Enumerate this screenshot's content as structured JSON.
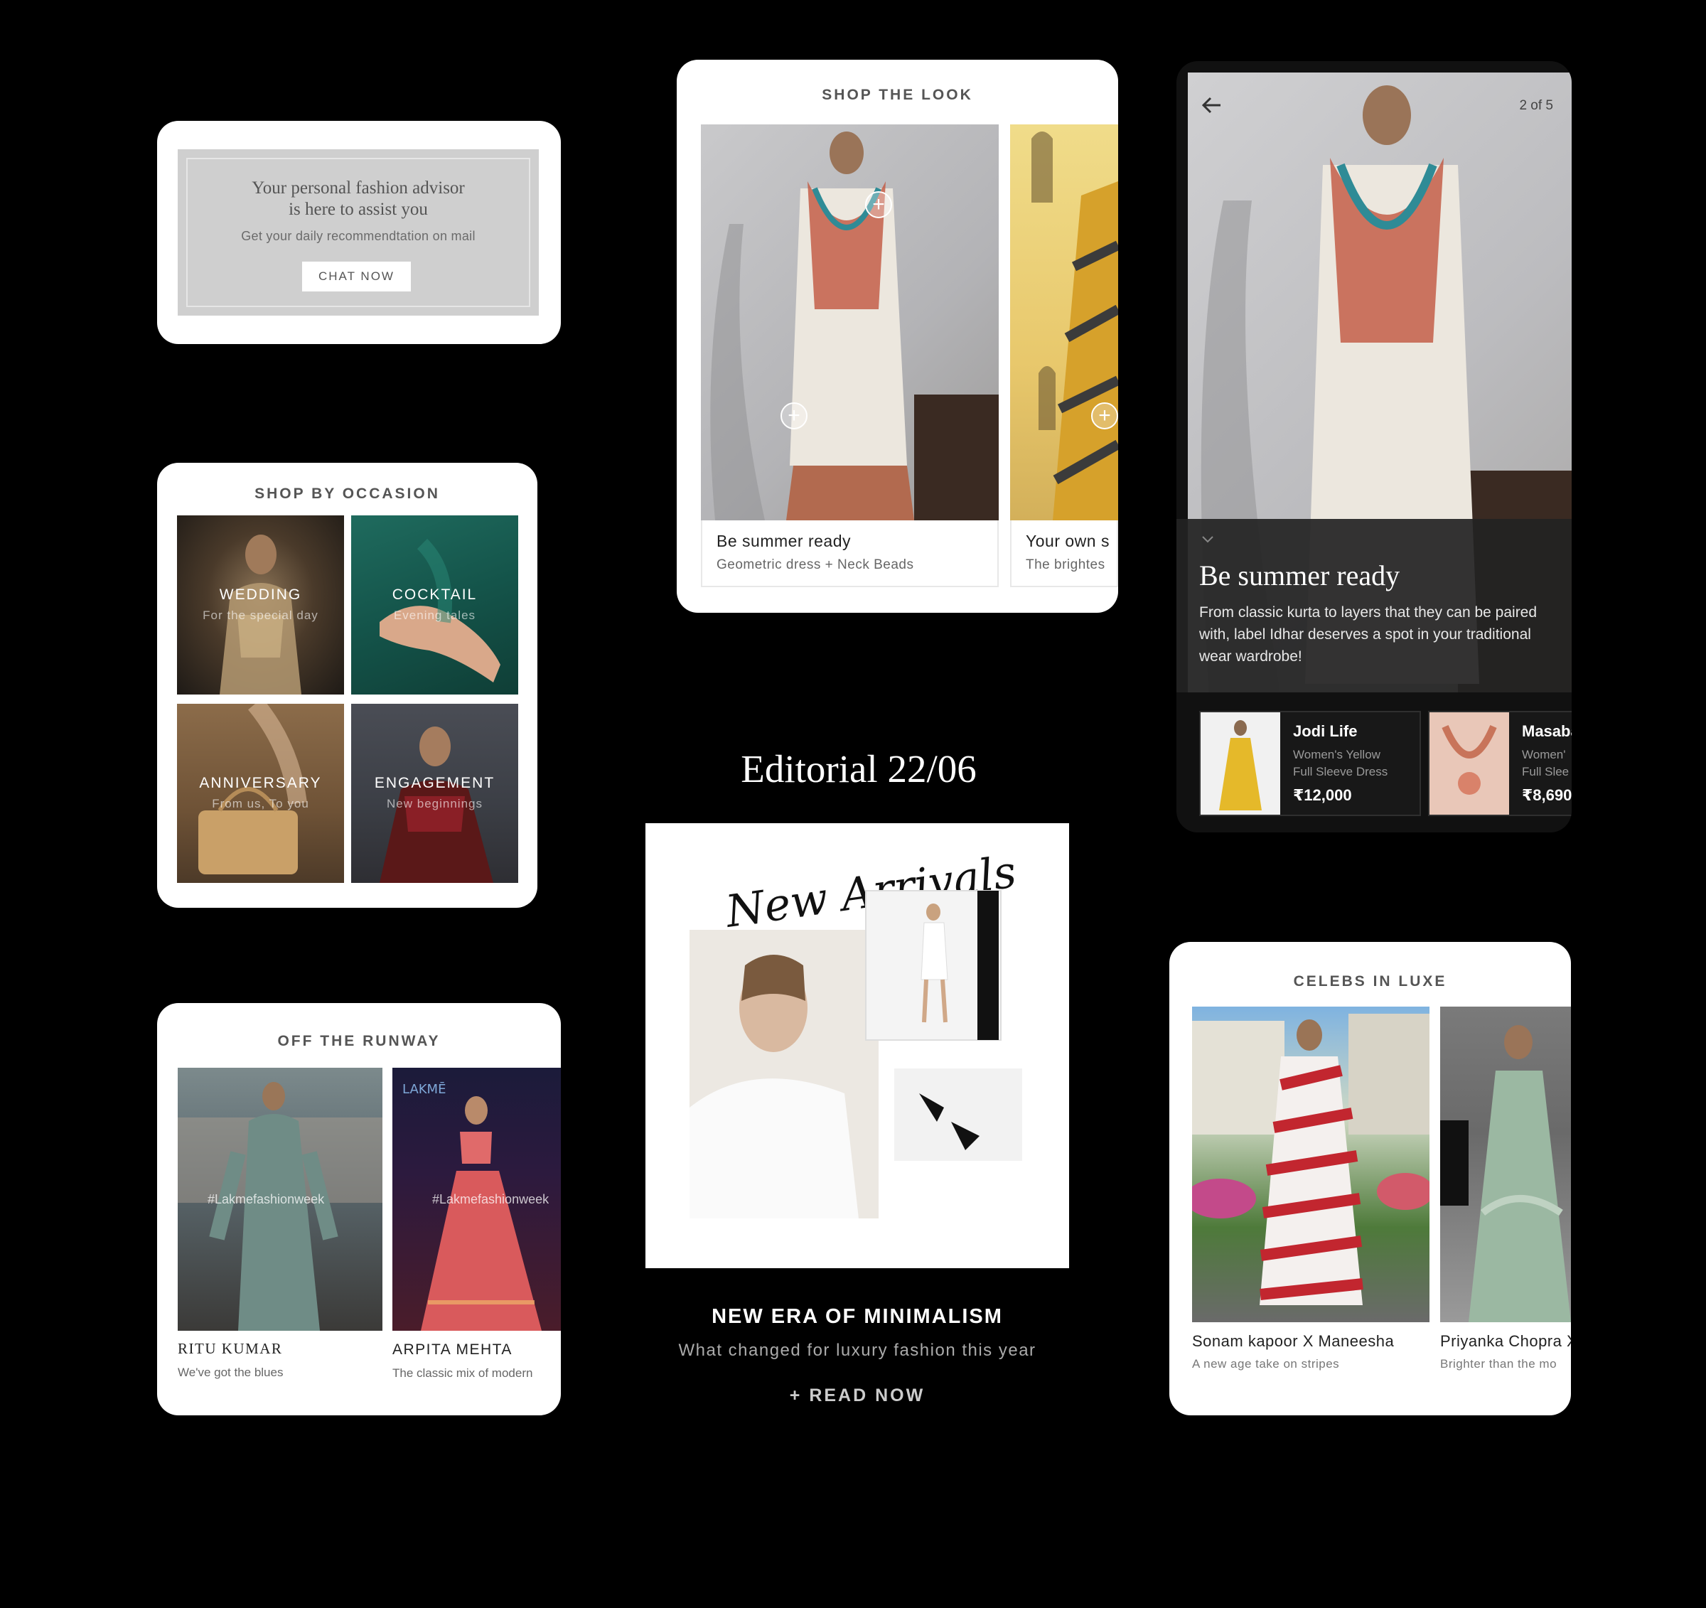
{
  "advisor": {
    "line1": "Your personal fashion advisor",
    "line2": "is here to assist you",
    "subtitle": "Get your daily recommendtation on mail",
    "cta": "CHAT NOW"
  },
  "occasion": {
    "heading": "SHOP BY OCCASION",
    "tiles": [
      {
        "label": "WEDDING",
        "sub": "For the special day"
      },
      {
        "label": "COCKTAIL",
        "sub": "Evening tales"
      },
      {
        "label": "ANNIVERSARY",
        "sub": "From us, To you"
      },
      {
        "label": "ENGAGEMENT",
        "sub": "New beginnings"
      }
    ]
  },
  "runway": {
    "heading": "OFF THE RUNWAY",
    "items": [
      {
        "name": "RITU KUMAR",
        "sub": "We've got the blues",
        "tag": "#Lakmefashionweek"
      },
      {
        "name": "ARPITA MEHTA",
        "sub": "The classic mix of modern",
        "tag": "#Lakmefashionweek"
      }
    ]
  },
  "shoplook": {
    "heading": "SHOP THE LOOK",
    "items": [
      {
        "title": "Be summer ready",
        "sub": "Geometric dress + Neck Beads"
      },
      {
        "title": "Your own s",
        "sub": "The brightes"
      }
    ]
  },
  "story": {
    "page": "2 of 5",
    "title": "Be summer ready",
    "description": "From classic kurta to layers that they can be paired with, label Idhar deserves a spot in your traditional wear wardrobe!",
    "products": [
      {
        "brand": "Jodi Life",
        "line1": "Women's Yellow",
        "line2": "Full Sleeve Dress",
        "price": "₹12,000"
      },
      {
        "brand": "Masaba",
        "line1": "Women'",
        "line2": "Full Slee",
        "price": "₹8,690"
      }
    ]
  },
  "editorial": {
    "title": "Editorial 22/06",
    "image_text": "New Arrivals",
    "headline": "NEW ERA OF MINIMALISM",
    "sub": "What changed for luxury fashion this year",
    "cta": "+ READ NOW"
  },
  "celebs": {
    "heading": "CELEBS IN LUXE",
    "items": [
      {
        "name": "Sonam kapoor X Maneesha",
        "sub": "A new age take on stripes"
      },
      {
        "name": "Priyanka Chopra X",
        "sub": "Brighter than the mo"
      }
    ]
  }
}
